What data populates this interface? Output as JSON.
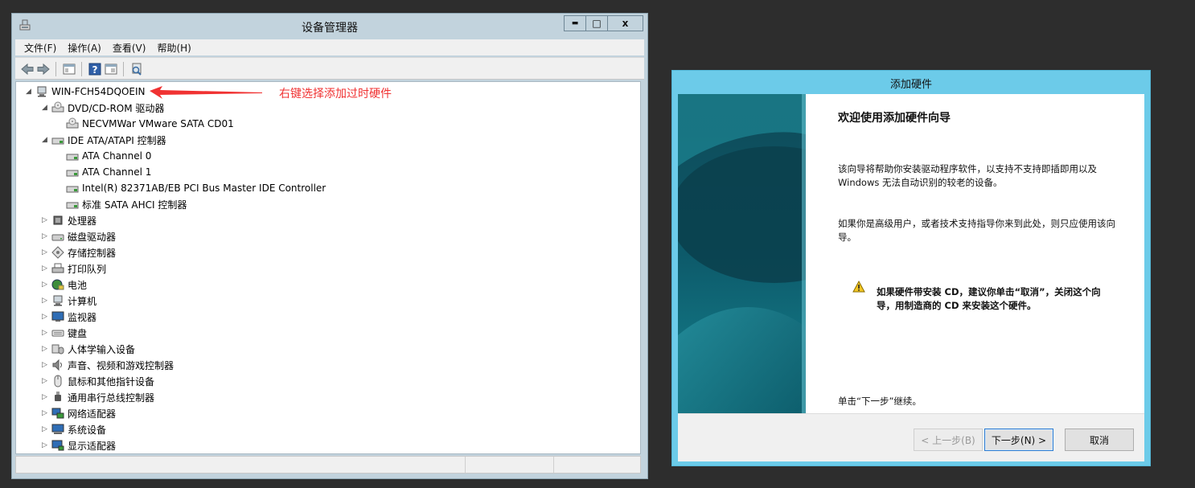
{
  "device_manager": {
    "title": "设备管理器",
    "window_buttons": {
      "minimize": "▬",
      "maximize": "□",
      "close": "x"
    },
    "menu": [
      "文件(F)",
      "操作(A)",
      "查看(V)",
      "帮助(H)"
    ],
    "tree": [
      {
        "label": "WIN-FCH54DQOEIN",
        "level": 0,
        "expander": "◢",
        "icon": "computer-icon"
      },
      {
        "label": "DVD/CD-ROM 驱动器",
        "level": 1,
        "expander": "◢",
        "icon": "dvd-drive-icon"
      },
      {
        "label": "NECVMWar VMware SATA CD01",
        "level": 2,
        "expander": "",
        "icon": "dvd-drive-icon"
      },
      {
        "label": "IDE ATA/ATAPI 控制器",
        "level": 1,
        "expander": "◢",
        "icon": "ide-controller-icon"
      },
      {
        "label": "ATA Channel 0",
        "level": 2,
        "expander": "",
        "icon": "ide-controller-icon"
      },
      {
        "label": "ATA Channel 1",
        "level": 2,
        "expander": "",
        "icon": "ide-controller-icon"
      },
      {
        "label": "Intel(R) 82371AB/EB PCI Bus Master IDE Controller",
        "level": 2,
        "expander": "",
        "icon": "ide-controller-icon"
      },
      {
        "label": "标准 SATA AHCI 控制器",
        "level": 2,
        "expander": "",
        "icon": "ide-controller-icon"
      },
      {
        "label": "处理器",
        "level": 1,
        "expander": "▷",
        "icon": "processor-icon"
      },
      {
        "label": "磁盘驱动器",
        "level": 1,
        "expander": "▷",
        "icon": "disk-drive-icon"
      },
      {
        "label": "存储控制器",
        "level": 1,
        "expander": "▷",
        "icon": "storage-controller-icon"
      },
      {
        "label": "打印队列",
        "level": 1,
        "expander": "▷",
        "icon": "printer-icon"
      },
      {
        "label": "电池",
        "level": 1,
        "expander": "▷",
        "icon": "battery-icon"
      },
      {
        "label": "计算机",
        "level": 1,
        "expander": "▷",
        "icon": "computer-icon"
      },
      {
        "label": "监视器",
        "level": 1,
        "expander": "▷",
        "icon": "monitor-icon"
      },
      {
        "label": "键盘",
        "level": 1,
        "expander": "▷",
        "icon": "keyboard-icon"
      },
      {
        "label": "人体学输入设备",
        "level": 1,
        "expander": "▷",
        "icon": "hid-icon"
      },
      {
        "label": "声音、视频和游戏控制器",
        "level": 1,
        "expander": "▷",
        "icon": "speaker-icon"
      },
      {
        "label": "鼠标和其他指针设备",
        "level": 1,
        "expander": "▷",
        "icon": "mouse-icon"
      },
      {
        "label": "通用串行总线控制器",
        "level": 1,
        "expander": "▷",
        "icon": "usb-icon"
      },
      {
        "label": "网络适配器",
        "level": 1,
        "expander": "▷",
        "icon": "network-adapter-icon"
      },
      {
        "label": "系统设备",
        "level": 1,
        "expander": "▷",
        "icon": "system-device-icon"
      },
      {
        "label": "显示适配器",
        "level": 1,
        "expander": "▷",
        "icon": "display-adapter-icon"
      }
    ]
  },
  "annotation": {
    "text": "右键选择添加过时硬件",
    "color": "#f03232"
  },
  "wizard": {
    "title": "添加硬件",
    "heading": "欢迎使用添加硬件向导",
    "para1": "该向导将帮助你安装驱动程序软件，以支持不支持即插即用以及 Windows 无法自动识别的较老的设备。",
    "para2": "如果你是高级用户，或者技术支持指导你来到此处，则只应使用该向导。",
    "warning": "如果硬件带安装 CD，建议你单击“取消”，关闭这个向导，用制造商的 CD 来安装这个硬件。",
    "continue": "单击“下一步”继续。",
    "buttons": {
      "back": "< 上一步(B)",
      "next": "下一步(N) >",
      "cancel": "取消"
    }
  },
  "colors": {
    "wizard_frame": "#6ccbe9",
    "dm_frame": "#c2d3dd",
    "desktop": "#2d2d2d"
  }
}
